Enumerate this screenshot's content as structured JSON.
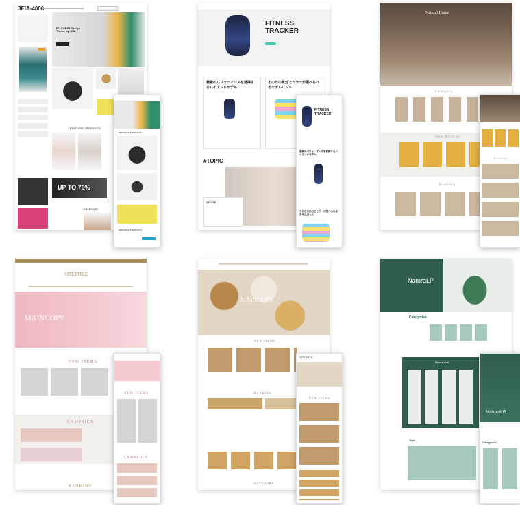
{
  "thumb1": {
    "logo": "JEIA-4006",
    "hero_title": "EC-CUBE4 Design Theme by JEIA",
    "section_featured": "FEATURED PRODUCTS",
    "promo": "UP TO 70%",
    "section_category": "CATEGORY",
    "section_featured_bottom": "FEATURED PRODUCTS",
    "colors": {
      "accent": "#2a9fd6",
      "dark": "#222222"
    }
  },
  "thumb2": {
    "hero_title_line1": "FITNESS",
    "hero_title_line2": "TRACKER",
    "card1_title": "最新のパフォーマンスを発揮するハイエンドモデル",
    "card2_title": "その日の気分でカラーが選べられるモデルバンド",
    "topic": "#TOPIC",
    "topic_label": "#YOGA",
    "mobile_hero_line1": "FITNESS",
    "mobile_hero_line2": "TRACKER",
    "mobile_card1": "最新のパフォーマンスを発揮するハイエンドモデル",
    "mobile_card2": "その日の気分でカラーが選べられるモデルバンド",
    "colors": {
      "accent": "#3cc9b0"
    }
  },
  "thumb3": {
    "hero_title": "Natural Home",
    "section_category": "Category",
    "section_new": "New Arrival",
    "section_ranking": "Ranking",
    "mobile_section": "Ranking"
  },
  "thumb4": {
    "logo": "SITETITLE",
    "hero_text": "MAINCOPY",
    "section_new": "NEW ITEMS",
    "section_campaign": "CAMPAIGN",
    "section_ranking": "RANKING",
    "mobile_new": "NEW ITEMS",
    "mobile_campaign": "CAMPAIGN",
    "colors": {
      "gold": "#a89060",
      "pink": "#e8a9b5"
    }
  },
  "thumb5": {
    "hero_text": "MAINCOPY",
    "section_new": "NEW ITEMS",
    "section_ranking": "RANKING",
    "section_category": "CATEGORY",
    "mobile_logo": "SITETITLE",
    "mobile_new": "NEW ITEMS"
  },
  "thumb6": {
    "logo": "NaturaLP",
    "section_categories": "Categories",
    "section_new": "New arrival",
    "section_tops": "Tops",
    "mobile_logo": "NaturaLP",
    "mobile_categories": "Categories",
    "colors": {
      "green": "#2f5e50"
    }
  }
}
